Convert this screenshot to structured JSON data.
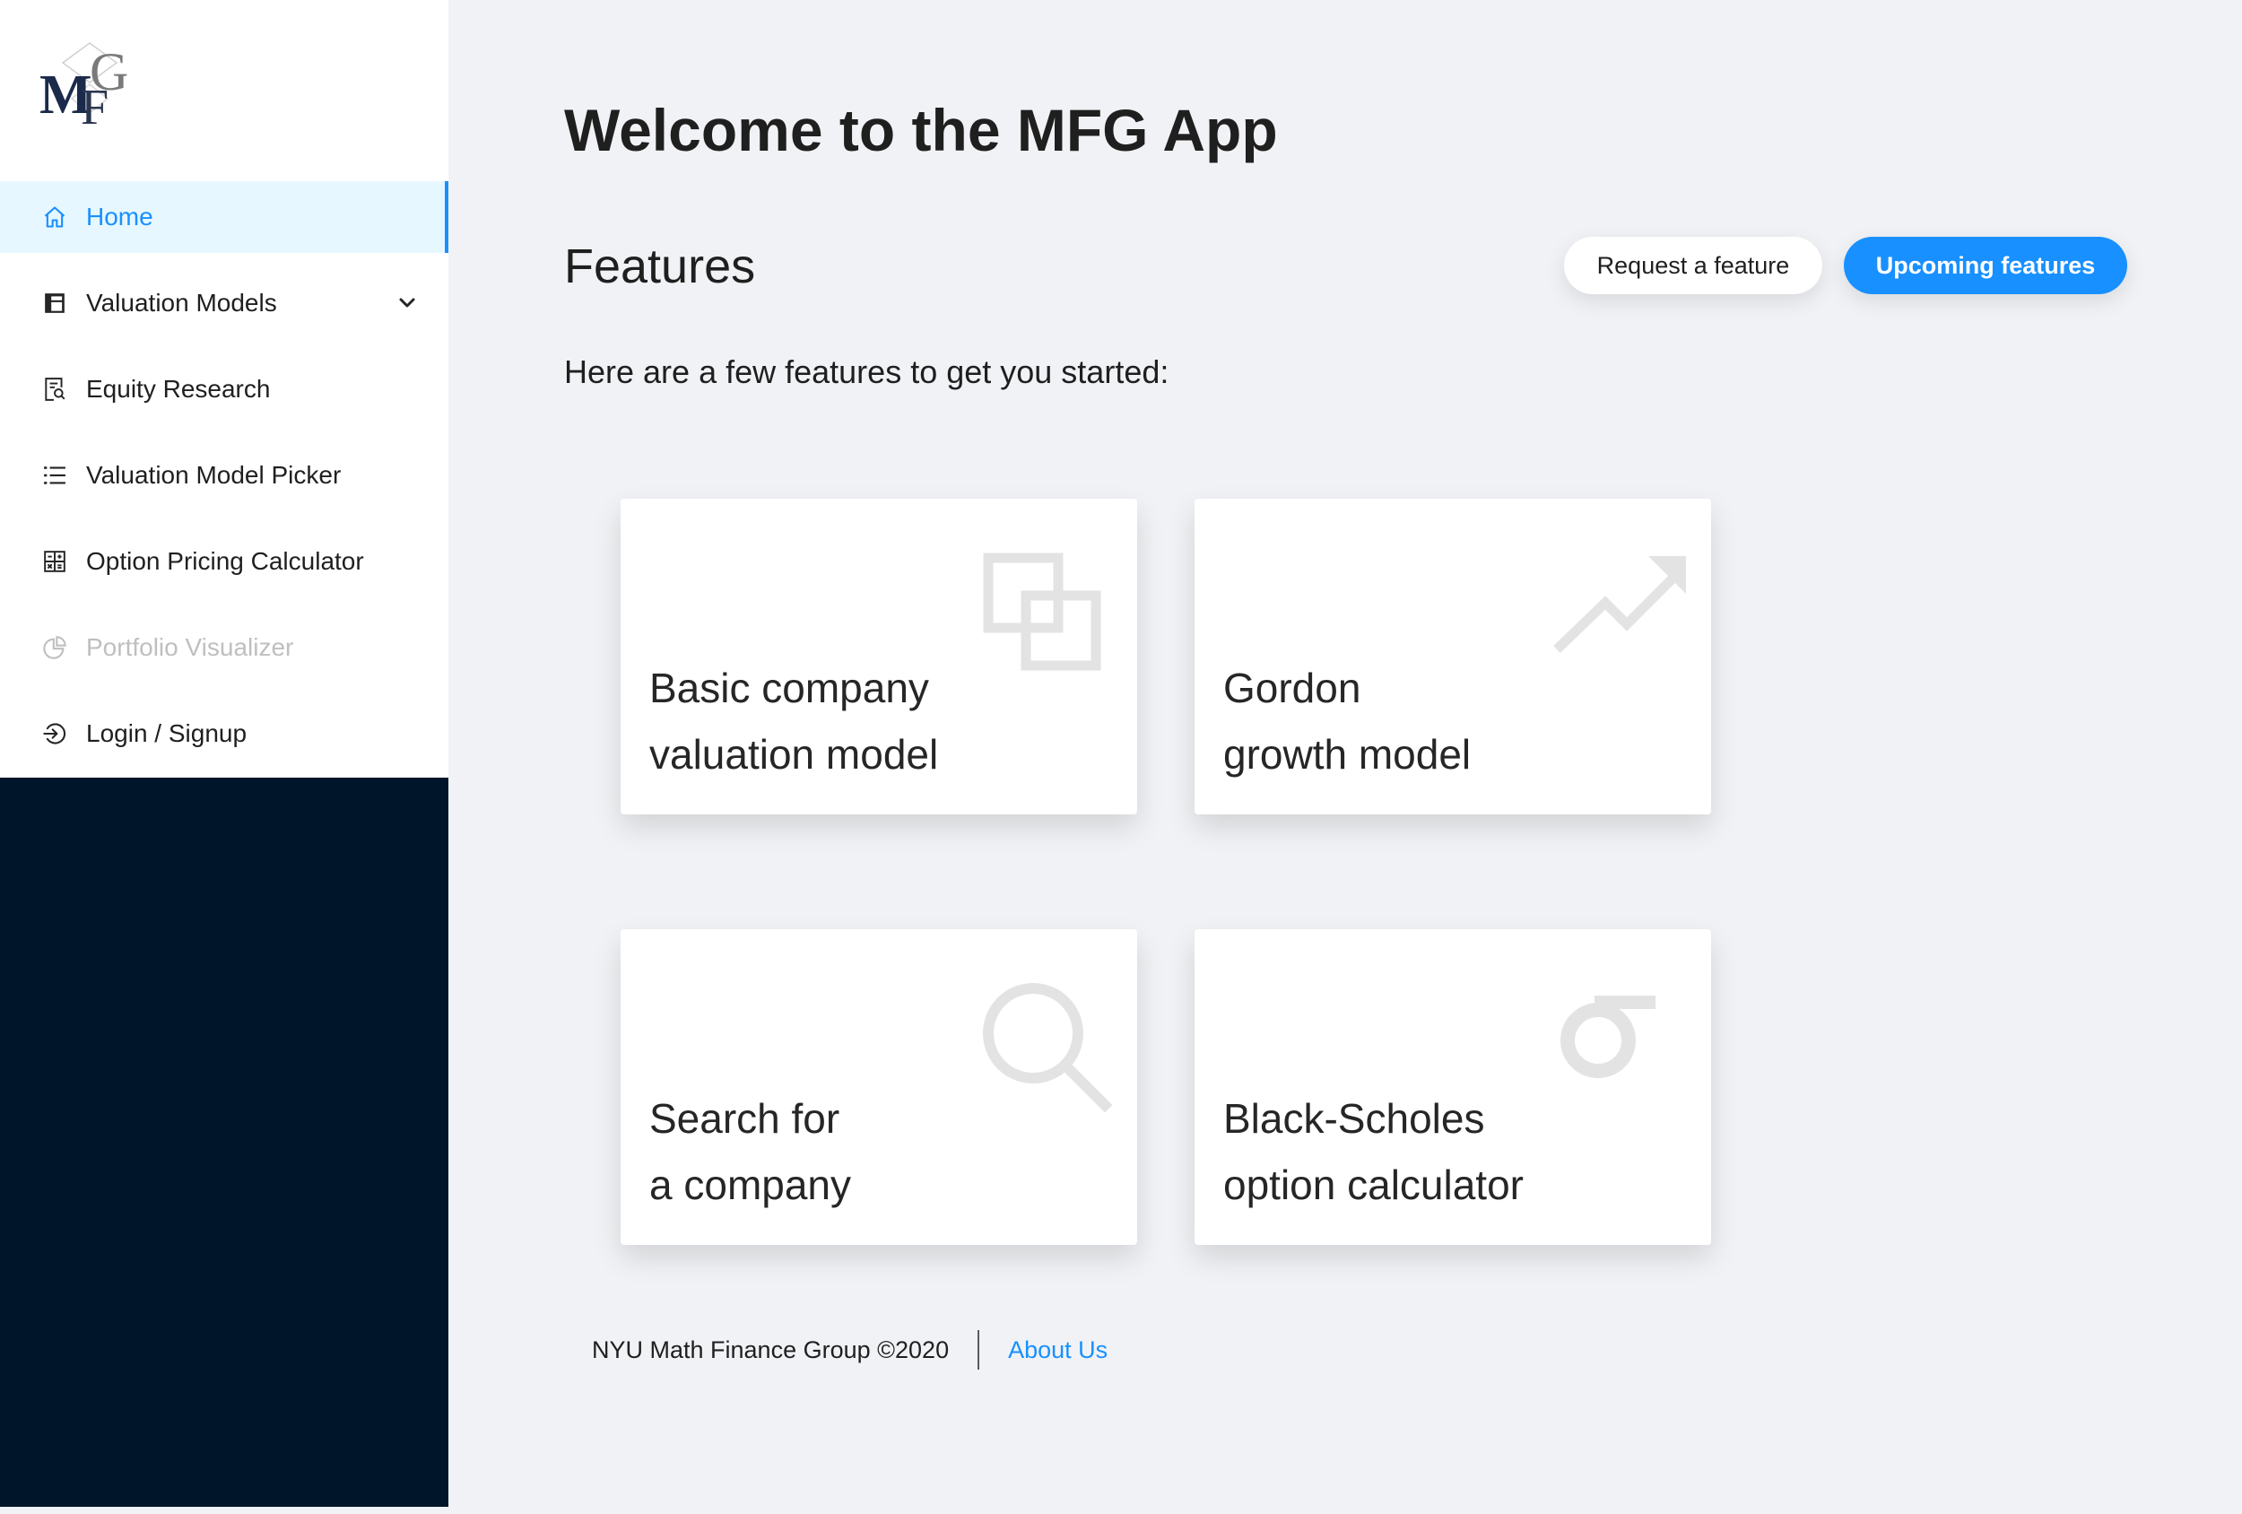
{
  "app": {
    "logo_text": "MFG"
  },
  "sidebar": {
    "items": [
      {
        "label": "Home",
        "icon": "home-icon",
        "active": true
      },
      {
        "label": "Valuation Models",
        "icon": "layout-icon",
        "has_submenu": true
      },
      {
        "label": "Equity Research",
        "icon": "file-search-icon"
      },
      {
        "label": "Valuation Model Picker",
        "icon": "list-icon"
      },
      {
        "label": "Option Pricing Calculator",
        "icon": "calculator-icon"
      },
      {
        "label": "Portfolio Visualizer",
        "icon": "pie-chart-icon",
        "disabled": true
      },
      {
        "label": "Login / Signup",
        "icon": "login-icon"
      }
    ]
  },
  "main": {
    "title": "Welcome to the MFG App",
    "features_heading": "Features",
    "request_button": "Request a feature",
    "upcoming_button": "Upcoming features",
    "intro": "Here are a few features to get you started:",
    "cards": [
      {
        "line1": "Basic company",
        "line2": "valuation model",
        "icon": "block-icon"
      },
      {
        "line1": "Gordon",
        "line2": "growth model",
        "icon": "rise-icon"
      },
      {
        "line1": "Search for",
        "line2": "a company",
        "icon": "search-icon"
      },
      {
        "line1": "Black-Scholes",
        "line2": "option calculator",
        "icon": "sigma-icon",
        "icon_glyph": "σ"
      }
    ]
  },
  "footer": {
    "copyright": "NYU Math Finance Group ©2020",
    "about_link": "About Us"
  },
  "colors": {
    "accent": "#1890ff",
    "sidebar_dark": "#001529",
    "background": "#f0f2f5",
    "active_bg": "#e6f7ff",
    "icon_muted": "#e3e3e3"
  }
}
